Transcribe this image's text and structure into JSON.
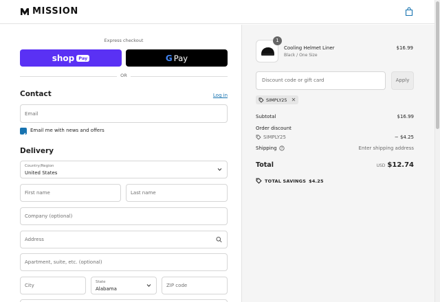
{
  "header": {
    "brand": "MISSION",
    "cart_icon": "shopping-bag-icon"
  },
  "express": {
    "label": "Express checkout",
    "shop_label": "shop",
    "shop_pay_pill": "Pay",
    "gpay_g": "G",
    "gpay_label": "Pay",
    "or": "OR"
  },
  "contact": {
    "title": "Contact",
    "login": "Log in",
    "email_placeholder": "Email",
    "newsletter_label": "Email me with news and offers",
    "newsletter_checked": true
  },
  "delivery": {
    "title": "Delivery",
    "country_label": "Country/Region",
    "country_value": "United States",
    "first_name_placeholder": "First name",
    "last_name_placeholder": "Last name",
    "company_placeholder": "Company (optional)",
    "address_placeholder": "Address",
    "apartment_placeholder": "Apartment, suite, etc. (optional)",
    "city_placeholder": "City",
    "state_label": "State",
    "state_value": "Alabama",
    "zip_placeholder": "ZIP code"
  },
  "summary": {
    "item": {
      "quantity": "1",
      "name": "Cooling Helmet Liner",
      "variant": "Black / One Size",
      "price": "$16.99"
    },
    "discount_placeholder": "Discount code or gift card",
    "apply_label": "Apply",
    "applied_code": "SIMPLY25",
    "subtotal_label": "Subtotal",
    "subtotal_value": "$16.99",
    "order_discount_label": "Order discount",
    "discount_code": "SIMPLY25",
    "discount_value": "− $4.25",
    "shipping_label": "Shipping",
    "shipping_value": "Enter shipping address",
    "total_label": "Total",
    "currency": "USD",
    "total_value": "$12.74",
    "savings_label": "TOTAL SAVINGS",
    "savings_value": "$4.25"
  },
  "colors": {
    "shop_pay": "#5a31f4",
    "link": "#1773b0",
    "gpay_bg": "#000000"
  }
}
